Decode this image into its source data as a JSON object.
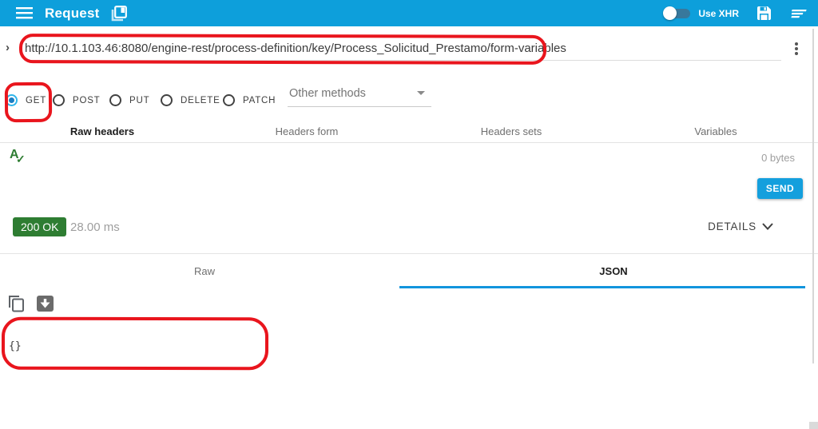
{
  "app": {
    "title": "Request",
    "use_xhr_label": "Use XHR"
  },
  "url_bar": {
    "value": "http://10.1.103.46:8080/engine-rest/process-definition/key/Process_Solicitud_Prestamo/form-variables"
  },
  "methods": {
    "options": [
      "GET",
      "POST",
      "PUT",
      "DELETE",
      "PATCH"
    ],
    "selected": "GET",
    "other_methods_label": "Other methods"
  },
  "headers_tabs": {
    "items": [
      "Raw headers",
      "Headers form",
      "Headers sets",
      "Variables"
    ],
    "selected": "Raw headers"
  },
  "request_editor": {
    "size_label": "0 bytes",
    "send_button_label": "SEND"
  },
  "response_status": {
    "status_label": "200 OK",
    "time_label": "28.00 ms",
    "details_label": "DETAILS"
  },
  "response_tabs": {
    "items": [
      "Raw",
      "JSON"
    ],
    "selected": "JSON"
  },
  "response_body": {
    "content": "{}"
  },
  "colors": {
    "appbar_blue": "#0d9fdb",
    "accent_blue": "#149fdd",
    "status_green": "#2e7d32",
    "annotation_red": "#e9151d",
    "radio_checked_ring": "#2fb5ea",
    "radio_checked_dot": "#1b7fc4"
  }
}
